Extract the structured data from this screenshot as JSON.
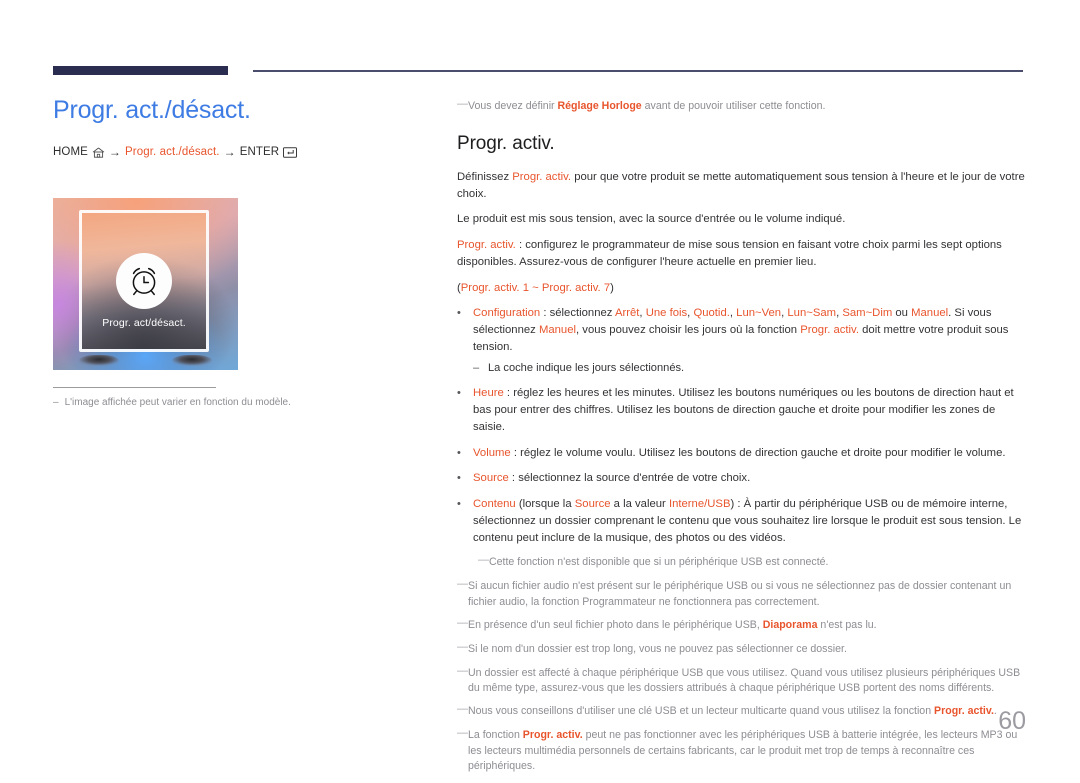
{
  "header": {
    "accent_bar_color": "#2b2d50",
    "rule_color": "#4a4d6b"
  },
  "left": {
    "title": "Progr. act./désact.",
    "breadcrumb": {
      "home_label": "HOME",
      "home_icon": "home-icon",
      "arrow_1": "→",
      "path_label": "Progr. act./désact.",
      "arrow_2": "→",
      "enter_label": "ENTER",
      "enter_icon": "enter-key-icon"
    },
    "thumbnail": {
      "screen_label": "Progr. act/désact.",
      "icon": "alarm-clock-icon"
    },
    "footnote": {
      "dash": "–",
      "text": "L'image affichée peut varier en fonction du modèle."
    }
  },
  "right": {
    "top_note": {
      "dash": "—",
      "pre": "Vous devez définir ",
      "accent": "Réglage Horloge",
      "post": " avant de pouvoir utiliser cette fonction."
    },
    "section_title": "Progr. activ.",
    "p1": {
      "pre": "Définissez ",
      "accent": "Progr. activ.",
      "post": " pour que votre produit se mette automatiquement sous tension à l'heure et le jour de votre choix."
    },
    "p2": "Le produit est mis sous tension, avec la source d'entrée ou le volume indiqué.",
    "p3": {
      "accent": "Progr. activ.",
      "post": " : configurez le programmateur de mise sous tension en faisant votre choix parmi les sept options disponibles. Assurez-vous de configurer l'heure actuelle en premier lieu."
    },
    "p4": {
      "open": "(",
      "a1": "Progr. activ. 1",
      "sep": " ~ ",
      "a2": "Progr. activ. 7",
      "close": ")"
    },
    "bullets": [
      {
        "name": "configuration",
        "dot": "•",
        "label": "Configuration",
        "body_1": " : sélectionnez ",
        "opts": [
          "Arrêt",
          "Une fois",
          "Quotid.",
          "Lun~Ven",
          "Lun~Sam",
          "Sam~Dim"
        ],
        "body_2": " ou ",
        "opt_last": "Manuel",
        "body_3": ". Si vous sélectionnez ",
        "opt_manual": "Manuel",
        "body_4": ", vous pouvez choisir les jours où la fonction ",
        "opt_prog": "Progr. activ.",
        "body_5": " doit mettre votre produit sous tension."
      },
      {
        "name": "heure",
        "dot": "•",
        "label": "Heure",
        "body": " : réglez les heures et les minutes. Utilisez les boutons numériques ou les boutons de direction haut et bas pour entrer des chiffres. Utilisez les boutons de direction gauche et droite pour modifier les zones de saisie."
      },
      {
        "name": "volume",
        "dot": "•",
        "label": "Volume",
        "body": " : réglez le volume voulu. Utilisez les boutons de direction gauche et droite pour modifier le volume."
      },
      {
        "name": "source",
        "dot": "•",
        "label": "Source",
        "body": " : sélectionnez la source d'entrée de votre choix."
      }
    ],
    "subdash_coche": {
      "dash": "–",
      "text": "La coche indique les jours sélectionnés."
    },
    "bullet_contenu": {
      "dot": "•",
      "label": "Contenu",
      "body_1": " (lorsque la ",
      "a_source": "Source",
      "body_2": " a la valeur ",
      "a_interne": "Interne/USB",
      "body_3": ") : À partir du périphérique USB ou de mémoire interne, sélectionnez un dossier comprenant le contenu que vous souhaitez lire lorsque le produit est sous tension. Le contenu peut inclure de la musique, des photos ou des vidéos."
    },
    "notes": [
      {
        "name": "note-usb-connecte",
        "dash": "—",
        "indent": true,
        "text": "Cette fonction n'est disponible que si un périphérique USB est connecté."
      },
      {
        "name": "note-fichier-audio",
        "dash": "—",
        "indent": false,
        "text": "Si aucun fichier audio n'est présent sur le périphérique USB ou si vous ne sélectionnez pas de dossier contenant un fichier audio, la fonction Programmateur ne fonctionnera pas correctement."
      },
      {
        "name": "note-diaporama",
        "dash": "—",
        "indent": false,
        "pre": "En présence d'un seul fichier photo dans le périphérique USB, ",
        "accent": "Diaporama",
        "post": " n'est pas lu."
      },
      {
        "name": "note-nom-dossier",
        "dash": "—",
        "indent": false,
        "text": "Si le nom d'un dossier est trop long, vous ne pouvez pas sélectionner ce dossier."
      },
      {
        "name": "note-dossier-affecte",
        "dash": "—",
        "indent": false,
        "text": "Un dossier est affecté à chaque périphérique USB que vous utilisez. Quand vous utilisez plusieurs périphériques USB du même type, assurez-vous que les dossiers attribués à chaque périphérique USB portent des noms différents."
      },
      {
        "name": "note-cle-usb",
        "dash": "—",
        "indent": false,
        "pre": "Nous vous conseillons d'utiliser une clé USB et un lecteur multicarte quand vous utilisez la fonction ",
        "accent": "Progr. activ.",
        "post": "."
      },
      {
        "name": "note-batterie",
        "dash": "—",
        "indent": false,
        "pre": "La fonction ",
        "accent": "Progr. activ.",
        "post": " peut ne pas fonctionner avec les périphériques USB à batterie intégrée, les lecteurs MP3 ou les lecteurs multimédia personnels de certains fabricants, car le produit met trop de temps à reconnaître ces périphériques."
      }
    ]
  },
  "footer": {
    "page_number": "60"
  },
  "colors": {
    "accent_orange": "#e8552d",
    "title_blue": "#3e7ce4",
    "navy": "#2b2d50",
    "body_gray": "#333336",
    "note_gray": "#8d8d93"
  }
}
